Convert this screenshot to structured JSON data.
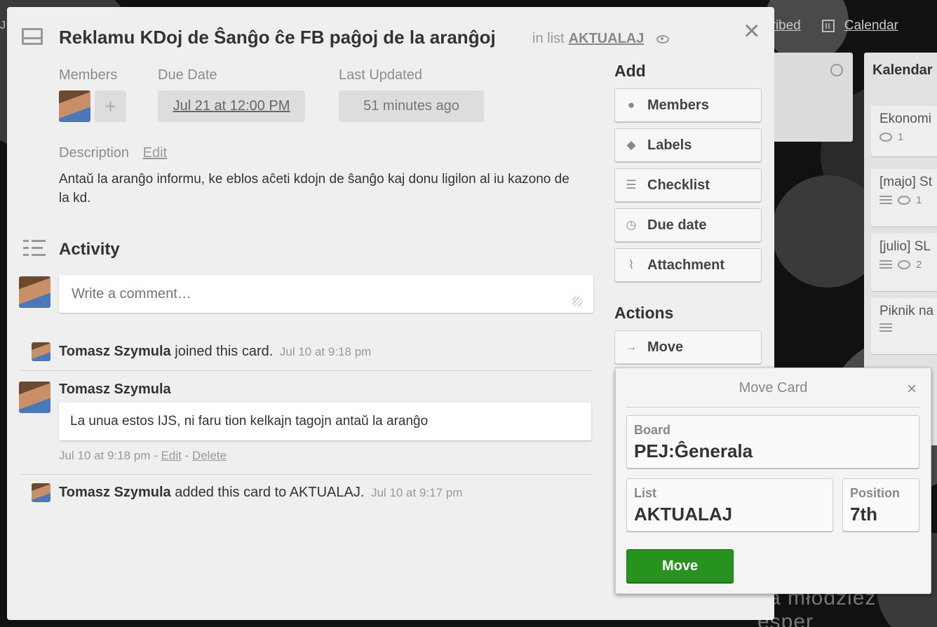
{
  "card": {
    "title": "Reklamu KDoj de Ŝanĝo ĉe FB paĝoj de la aranĝoj",
    "in_list_prefix": "in list",
    "list_name": "AKTUALAJ",
    "close_glyph": "×"
  },
  "meta": {
    "members_label": "Members",
    "add_member_glyph": "+",
    "due_label": "Due Date",
    "due_value": "Jul 21 at 12:00 PM",
    "updated_label": "Last Updated",
    "updated_value": "51 minutes ago"
  },
  "description": {
    "label": "Description",
    "edit": "Edit",
    "text": "Antaŭ la aranĝo informu, ke eblos aĉeti kdojn de ŝanĝo kaj donu ligilon al iu kazono de la kd."
  },
  "activity": {
    "title": "Activity",
    "comment_placeholder": "Write a comment…",
    "entries": [
      {
        "user": "Tomasz Szymula",
        "action": "joined this card.",
        "time": "Jul 10 at 9:18 pm"
      },
      {
        "user": "Tomasz Szymula",
        "comment": "La unua estos IJS, ni faru tion kelkajn tagojn antaŭ la aranĝo",
        "time": "Jul 10 at 9:18 pm",
        "sep1": " - ",
        "edit": "Edit",
        "sep2": " - ",
        "delete": "Delete"
      },
      {
        "user": "Tomasz Szymula",
        "action": "added this card to AKTUALAJ.",
        "time": "Jul 10 at 9:17 pm"
      }
    ]
  },
  "sidebar": {
    "add_title": "Add",
    "add_buttons": [
      {
        "label": "Members",
        "icon": "person-icon",
        "glyph": "●"
      },
      {
        "label": "Labels",
        "icon": "tag-icon",
        "glyph": "◆"
      },
      {
        "label": "Checklist",
        "icon": "checklist-icon",
        "glyph": "☰"
      },
      {
        "label": "Due date",
        "icon": "clock-icon",
        "glyph": "◷"
      },
      {
        "label": "Attachment",
        "icon": "paperclip-icon",
        "glyph": "⌇"
      }
    ],
    "actions_title": "Actions",
    "move_label": "Move",
    "move_glyph": "→"
  },
  "move_popover": {
    "title": "Move Card",
    "close_glyph": "×",
    "board_label": "Board",
    "board_value": "PEJ:Ĝenerala",
    "list_label": "List",
    "list_value": "AKTUALAJ",
    "position_label": "Position",
    "position_value": "7th",
    "submit": "Move"
  },
  "background": {
    "subscribed_partial": "cribed",
    "calendar_link": "Calendar",
    "left_partial": "J",
    "list_b_title": "Kalendar",
    "cards": [
      {
        "title": "Ekonomi",
        "comments": "1",
        "has_desc": false
      },
      {
        "title": "[majo] St",
        "comments": "1",
        "has_desc": true
      },
      {
        "title": "[julio] SL",
        "comments": "2",
        "has_desc": true
      },
      {
        "title": "Piknik na",
        "comments": "",
        "has_desc": true
      }
    ],
    "slogan": "ka młodzież esper"
  },
  "colors": {
    "primary_green": "#27921d",
    "window_bg": "#efefef",
    "backdrop": "#111111"
  }
}
